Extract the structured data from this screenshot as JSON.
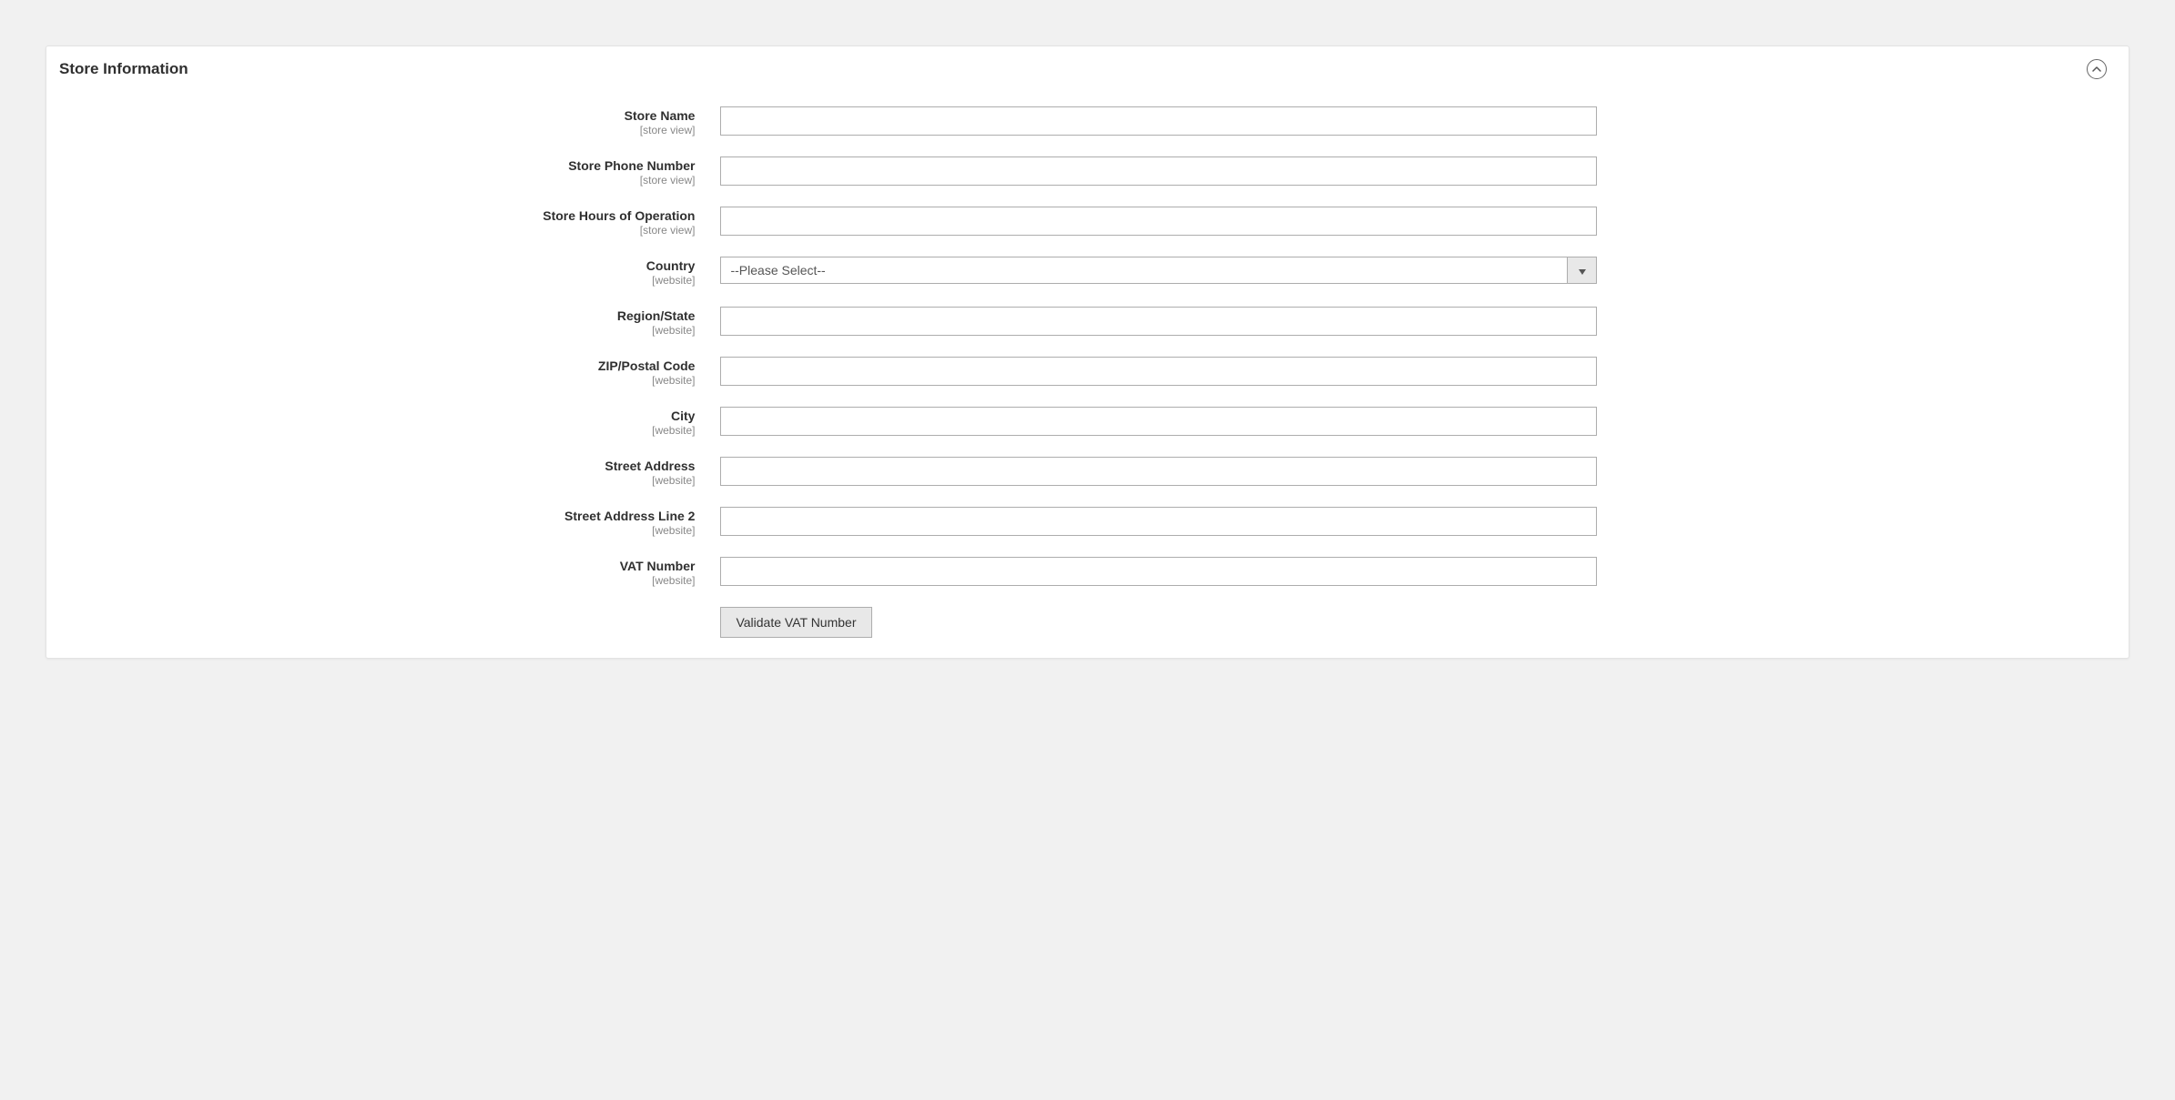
{
  "section": {
    "title": "Store Information"
  },
  "scopes": {
    "store_view": "[store view]",
    "website": "[website]"
  },
  "fields": {
    "store_name": {
      "label": "Store Name",
      "value": ""
    },
    "store_phone": {
      "label": "Store Phone Number",
      "value": ""
    },
    "store_hours": {
      "label": "Store Hours of Operation",
      "value": ""
    },
    "country": {
      "label": "Country",
      "selected": "--Please Select--"
    },
    "region_state": {
      "label": "Region/State",
      "value": ""
    },
    "zip": {
      "label": "ZIP/Postal Code",
      "value": ""
    },
    "city": {
      "label": "City",
      "value": ""
    },
    "street1": {
      "label": "Street Address",
      "value": ""
    },
    "street2": {
      "label": "Street Address Line 2",
      "value": ""
    },
    "vat": {
      "label": "VAT Number",
      "value": ""
    }
  },
  "actions": {
    "validate_vat": "Validate VAT Number"
  }
}
